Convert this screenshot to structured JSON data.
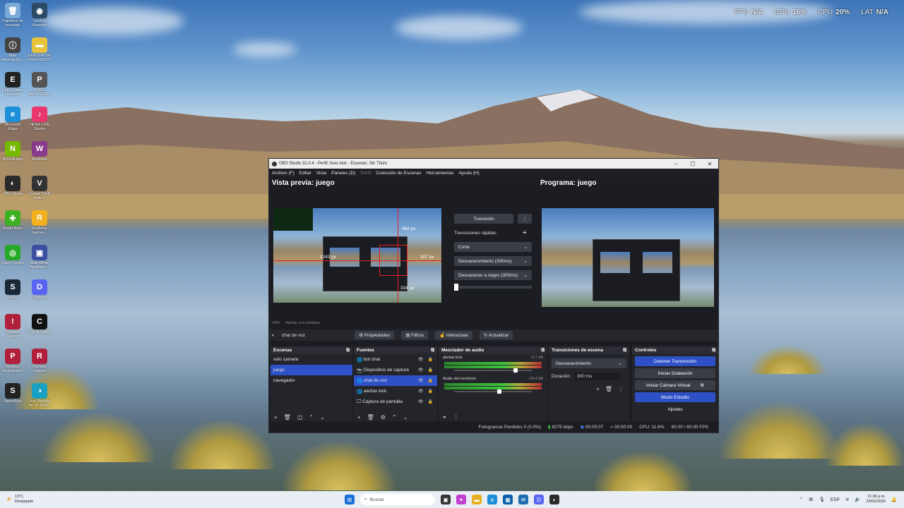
{
  "overlay": {
    "fps_label": "FPS",
    "fps": "N/A",
    "gpu_label": "GPU",
    "gpu": "16%",
    "cpu_label": "CPU",
    "cpu": "20%",
    "lat_label": "LAT",
    "lat": "N/A"
  },
  "desktop_icons": [
    {
      "name": "recycle-bin-icon",
      "label": "Papelera de reciclaje",
      "color": "#7aa9d8",
      "glyph": "🗑"
    },
    {
      "name": "davinci-icon",
      "label": "DaVinci Resolve",
      "color": "#2b4b66",
      "glyph": "◉"
    },
    {
      "name": "info-icon",
      "label": "Más información...",
      "color": "#444",
      "glyph": "ⓘ"
    },
    {
      "name": "folder-icon",
      "label": "EDICION DE VIDEOS/STC",
      "color": "#e8c23a",
      "glyph": "▬"
    },
    {
      "name": "epic-games-icon",
      "label": "Epic Games Launcher",
      "color": "#222",
      "glyph": "E"
    },
    {
      "name": "pubg-icon",
      "label": "PUBG BATTLEGR...",
      "color": "#555",
      "glyph": "P"
    },
    {
      "name": "edge-icon",
      "label": "Microsoft Edge",
      "color": "#1d8fd8",
      "glyph": "e"
    },
    {
      "name": "tiktok-icon",
      "label": "TikTok LIVE Studio",
      "color": "#e8366f",
      "glyph": "♪"
    },
    {
      "name": "nvidia-icon",
      "label": "NVIDIA App",
      "color": "#76b900",
      "glyph": "N"
    },
    {
      "name": "winrar-icon",
      "label": "WinRAR",
      "color": "#8a3a8a",
      "glyph": "W"
    },
    {
      "name": "obs-icon",
      "label": "OBS Studio",
      "color": "#2a2a2a",
      "glyph": "◐"
    },
    {
      "name": "gta-icon",
      "label": "Grand Theft Auto V",
      "color": "#333",
      "glyph": "V"
    },
    {
      "name": "rapidr-icon",
      "label": "Razer Axon",
      "color": "#3cb020",
      "glyph": "✚"
    },
    {
      "name": "rockstar-icon",
      "label": "Rockstar Games...",
      "color": "#f2b01c",
      "glyph": "R"
    },
    {
      "name": "razer-cortex-icon",
      "label": "Razer Cortex",
      "color": "#28a828",
      "glyph": "◎"
    },
    {
      "name": "blue-white-icon",
      "label": "Blue White Aesthetic...",
      "color": "#3a4fa0",
      "glyph": "▣"
    },
    {
      "name": "steam-icon",
      "label": "Steam",
      "color": "#1b2838",
      "glyph": "S"
    },
    {
      "name": "discord-icon",
      "label": "Discord",
      "color": "#5865f2",
      "glyph": "D"
    },
    {
      "name": "contact-icon",
      "label": "Contact Support",
      "color": "#b0203a",
      "glyph": "!"
    },
    {
      "name": "cod-icon",
      "label": "Call of Duty®",
      "color": "#111",
      "glyph": "C"
    },
    {
      "name": "product-reg-icon",
      "label": "Product Registration",
      "color": "#b0203a",
      "glyph": "P"
    },
    {
      "name": "remote-support-icon",
      "label": "Remote Support",
      "color": "#b0203a",
      "glyph": "R"
    },
    {
      "name": "signalrgb-icon",
      "label": "SignalRgb",
      "color": "#222",
      "glyph": "S"
    },
    {
      "name": "test-results-icon",
      "label": "Test Results for ST-B80...",
      "color": "#1aa0c0",
      "glyph": "◑"
    }
  ],
  "obs": {
    "title": "OBS Studio 32.0.4 - Perfil: lives kick - Escenas: Sin Título",
    "menu": [
      "Archivo (F)",
      "Editar",
      "Vista",
      "Paneles (D)",
      "Perfil",
      "Colección de Escenas",
      "Herramientas",
      "Ayuda (H)"
    ],
    "preview_title": "Vista previa: juego",
    "program_title": "Programa: juego",
    "preview_labels": {
      "top": "469 px",
      "left": "1243 px",
      "right": "307 px",
      "bottom": "334 px"
    },
    "zoom": "24%",
    "zoom_fit": "Ajustar a la ventana",
    "transition_btn": "Transición",
    "quick_transitions": "Transiciones rápidas",
    "transitions": [
      "Corte",
      "Desvanecimiento (300ms)",
      "Desvanecer a negro (300ms)"
    ],
    "source_name": "chat de voz",
    "toolbar": {
      "props": "Propiedades",
      "filters": "Filtros",
      "interact": "Interactuar",
      "refresh": "Actualizar"
    },
    "scenes": {
      "title": "Escenas",
      "items": [
        "solo camara",
        "juego",
        "navegador"
      ]
    },
    "sources": {
      "title": "Fuentes",
      "items": [
        "bot chat",
        "Dispositivo de captura",
        "chat de voz",
        "alertas kick",
        "Captura de pantalla"
      ]
    },
    "mixer": {
      "title": "Mezclador de audio",
      "ch1": "alertas kick",
      "db1": "-6.7 dB",
      "ch2": "Audio del escritorio",
      "db2": "-23.4 dB"
    },
    "scene_trans": {
      "title": "Transiciones de escena",
      "type": "Desvanecimiento",
      "duration_label": "Duración",
      "duration": "300 ms"
    },
    "controls": {
      "title": "Controles",
      "stop": "Detener Transmisión",
      "record": "Iniciar Grabación",
      "vcam": "Iniciar Cámara Virtual",
      "studio": "Modo Estudio",
      "settings": "Ajustes"
    },
    "status": {
      "dropped": "Fotogramas Perdidos 0 (0.0%)",
      "kbps": "8275 kbps",
      "time": "00:05:07",
      "rec": "00:00:00",
      "cpu": "CPU: 11.6%",
      "fps": "60.00 / 60.00 FPS"
    }
  },
  "taskbar": {
    "weather_temp": "13°C",
    "weather_desc": "Despejado",
    "search": "Buscar",
    "lang": "ESP",
    "time": "11:36 p.m.",
    "date": "23/02/2026"
  }
}
